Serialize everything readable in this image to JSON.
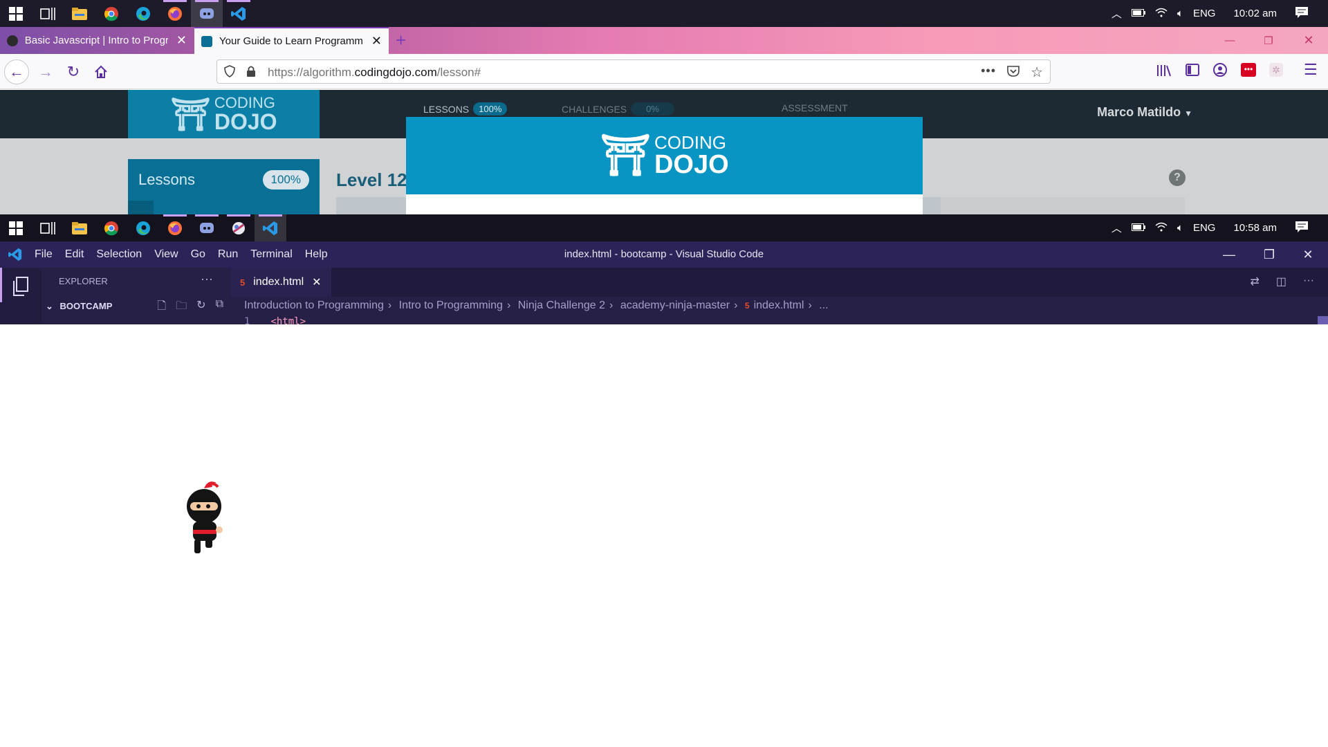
{
  "taskbar_top": {
    "clock": "10:02 am",
    "language": "ENG",
    "apps": [
      "start-icon",
      "task-view-icon",
      "file-explorer-icon",
      "chrome-icon",
      "edge-icon",
      "firefox-icon",
      "discord-icon",
      "vscode-icon"
    ]
  },
  "firefox": {
    "tabs": [
      {
        "title": "Basic Javascript | Intro to Progra",
        "favicon_color": "#2b2b2b"
      },
      {
        "title": "Your Guide to Learn Programmi",
        "favicon_color": "#0a6f94"
      }
    ],
    "url": {
      "prefix": "https://algorithm.",
      "domain": "codingdojo.com",
      "path": "/lesson#"
    }
  },
  "page": {
    "logo_top": "CODING",
    "logo_bottom": "DOJO",
    "nav": [
      {
        "label": "LESSONS",
        "badge": "100%"
      },
      {
        "label": "CHALLENGES",
        "badge": "0%"
      },
      {
        "label": "ASSESSMENT",
        "badge": ""
      }
    ],
    "user_name": "Marco Matildo",
    "lessons_title": "Lessons",
    "lessons_progress": "100%",
    "level_title": "Level 12",
    "help_symbol": "?"
  },
  "modal": {
    "logo_top": "CODING",
    "logo_bottom": "DOJO"
  },
  "taskbar_bottom": {
    "clock": "10:58 am",
    "language": "ENG"
  },
  "vscode": {
    "menu": [
      "File",
      "Edit",
      "Selection",
      "View",
      "Go",
      "Run",
      "Terminal",
      "Help"
    ],
    "window_title": "index.html - bootcamp - Visual Studio Code",
    "explorer_label": "EXPLORER",
    "folder_name": "BOOTCAMP",
    "tab_label": "index.html",
    "breadcrumb": [
      "Introduction to Programming",
      "Intro to Programming",
      "Ninja Challenge 2",
      "academy-ninja-master",
      "index.html",
      "..."
    ],
    "line_number": "1",
    "code": "<html>"
  },
  "colors": {
    "accent_purple": "#2c2458",
    "dojo_blue": "#0895c4"
  }
}
